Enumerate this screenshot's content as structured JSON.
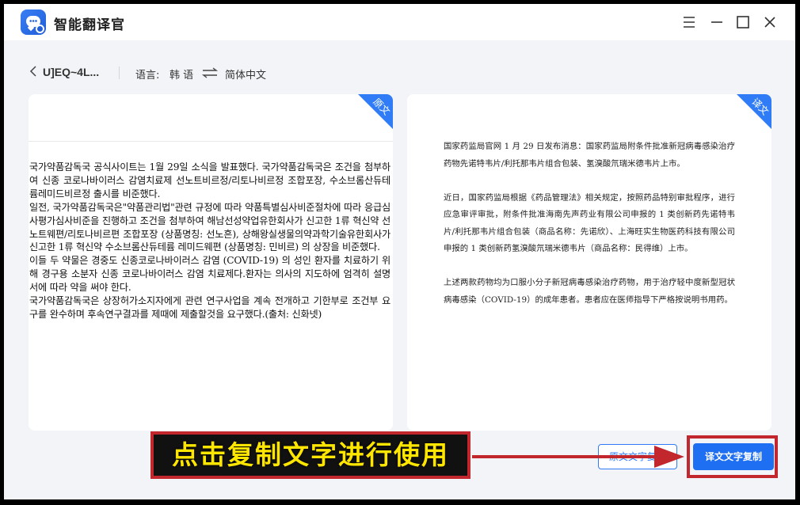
{
  "app": {
    "title": "智能翻译官"
  },
  "toolbar": {
    "file_name": "U]EQ~4L...",
    "language_label": "语言:",
    "source_language": "韩 语",
    "target_language": "简体中文"
  },
  "source_panel": {
    "corner_label": "原文",
    "paragraphs": [
      "국가약품감독국 공식사이트는 1월 29일 소식을 발표했다. 국가약품감독국은 조건을 첨부하여 신종 코로나바이러스 감염치료제 선노트비르정/리토나비르정 조합포장, 수소브롬산듀테륨레미드비르정 출시를 비준했다.",
      "일전, 국가약품감독국은\"약품관리법\"관련 규정에 따라 약품특별심사비준절차에 따라 응급심사평가심사비준을 진행하고 조건을 첨부하여 해남선성약업유한회사가 신고한 1류 혁신약 선노트웨편/리토나비르편 조합포장 (상품명칭: 선노흔), 상해왕실생물의약과학기술유한회사가 신고한 1류 혁신약 수소브롬산듀테륨 레미드웨편 (상품명칭: 민비르) 의 상장을 비준했다.",
      "이들 두 약물은 경중도 신종코로나바이러스 감염 (COVID-19) 의 성인 환자를 치료하기 위해 경구용 소분자 신종 코로나바이러스 감염 치료제다.환자는 의사의 지도하에 엄격히 설명서에 따라 약을 써야 한다.",
      "국가약품감독국은 상장허가소지자에게 관련 연구사업을 계속 전개하고 기한부로 조건부 요구를 완수하며 후속연구결과를 제때에 제출할것을 요구했다.(출처: 신화넷)"
    ]
  },
  "target_panel": {
    "corner_label": "译文",
    "paragraphs": [
      "国家药监局官网 1 月 29 日发布消息：国家药监局附条件批准新冠病毒感染治疗药物先诺特韦片/利托那韦片组合包装、氢溴酸氘瑞米德韦片上市。",
      "近日，国家药监局根据《药品管理法》相关规定，按照药品特别审批程序，进行应急审评审批，附条件批准海南先声药业有限公司申报的 1 类创新药先诺特韦片/利托那韦片组合包装（商品名称：先诺欣）、上海旺实生物医药科技有限公司申报的 1 类创新药氢溴酸氘瑞米德韦片（商品名称：民得维）上市。",
      "上述两款药物均为口服小分子新冠病毒感染治疗药物，用于治疗轻中度新型冠状病毒感染（COVID-19）的成年患者。患者应在医师指导下严格按说明书用药。"
    ]
  },
  "footer": {
    "annotation": "点击复制文字进行使用",
    "copy_source_label": "原文文字复制",
    "copy_target_label": "译文文字复制"
  },
  "colors": {
    "accent": "#1f6ff2",
    "annotation_border": "#c1272d",
    "annotation_text": "#ffe600"
  }
}
